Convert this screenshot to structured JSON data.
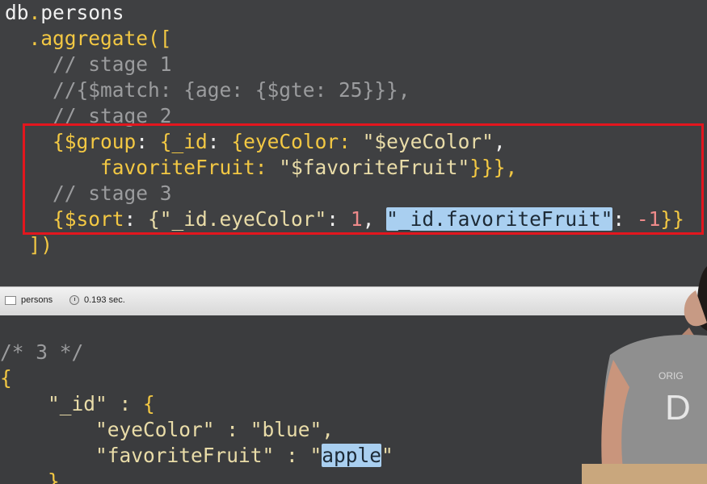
{
  "editor": {
    "lines": [
      {
        "parts": [
          {
            "t": "db",
            "c": "w"
          },
          {
            "t": ".",
            "c": "y"
          },
          {
            "t": "persons",
            "c": "w"
          }
        ]
      },
      {
        "parts": [
          {
            "t": "  .aggregate([",
            "c": "y"
          }
        ]
      },
      {
        "parts": [
          {
            "t": "    // stage 1",
            "c": "c"
          }
        ]
      },
      {
        "parts": [
          {
            "t": "    //{$match: {age: {$gte: 25}}},",
            "c": "c"
          }
        ]
      },
      {
        "parts": [
          {
            "t": "    // stage 2",
            "c": "c"
          }
        ]
      },
      {
        "parts": [
          {
            "t": "    {$group",
            "c": "y"
          },
          {
            "t": ": ",
            "c": "w"
          },
          {
            "t": "{_id",
            "c": "y"
          },
          {
            "t": ": ",
            "c": "w"
          },
          {
            "t": "{eyeColor: ",
            "c": "y"
          },
          {
            "t": "\"$eyeColor\"",
            "c": "s"
          },
          {
            "t": ",",
            "c": "w"
          }
        ]
      },
      {
        "parts": [
          {
            "t": "        favoriteFruit: ",
            "c": "y"
          },
          {
            "t": "\"$favoriteFruit\"",
            "c": "s"
          },
          {
            "t": "}}},",
            "c": "y"
          }
        ]
      },
      {
        "parts": [
          {
            "t": "    // stage 3",
            "c": "c"
          }
        ]
      },
      {
        "parts": [
          {
            "t": "    {$sort",
            "c": "y"
          },
          {
            "t": ": ",
            "c": "w"
          },
          {
            "t": "{\"_id.eyeColor\"",
            "c": "s"
          },
          {
            "t": ": ",
            "c": "w"
          },
          {
            "t": "1",
            "c": "n"
          },
          {
            "t": ", ",
            "c": "w"
          },
          {
            "t": "\"_id.favoriteFruit\"",
            "c": "sel"
          },
          {
            "t": ": ",
            "c": "w"
          },
          {
            "t": "-1",
            "c": "n"
          },
          {
            "t": "}}",
            "c": "y"
          }
        ]
      },
      {
        "parts": [
          {
            "t": "  ])",
            "c": "y"
          }
        ]
      }
    ]
  },
  "statusbar": {
    "collection": "persons",
    "time": "0.193 sec."
  },
  "results": {
    "lines": [
      {
        "parts": [
          {
            "t": "/* 3 */",
            "c": "c"
          }
        ]
      },
      {
        "parts": [
          {
            "t": "{",
            "c": "y"
          }
        ]
      },
      {
        "parts": [
          {
            "t": "    \"_id\" : ",
            "c": "s"
          },
          {
            "t": "{",
            "c": "y"
          }
        ]
      },
      {
        "parts": [
          {
            "t": "        \"eyeColor\" : \"blue\",",
            "c": "s"
          }
        ]
      },
      {
        "parts": [
          {
            "t": "        \"favoriteFruit\" : \"",
            "c": "s"
          },
          {
            "t": "apple",
            "c": "sel"
          },
          {
            "t": "\"",
            "c": "s"
          }
        ]
      },
      {
        "parts": [
          {
            "t": "    }",
            "c": "y"
          }
        ]
      }
    ]
  },
  "colors": {
    "editor_bg": "#3f4042",
    "keyword": "#f3c843",
    "string": "#e9dca8",
    "comment": "#9b9c9e",
    "number": "#ee8a8a",
    "selection": "#a9cff0",
    "highlight_box": "#e3161e"
  }
}
